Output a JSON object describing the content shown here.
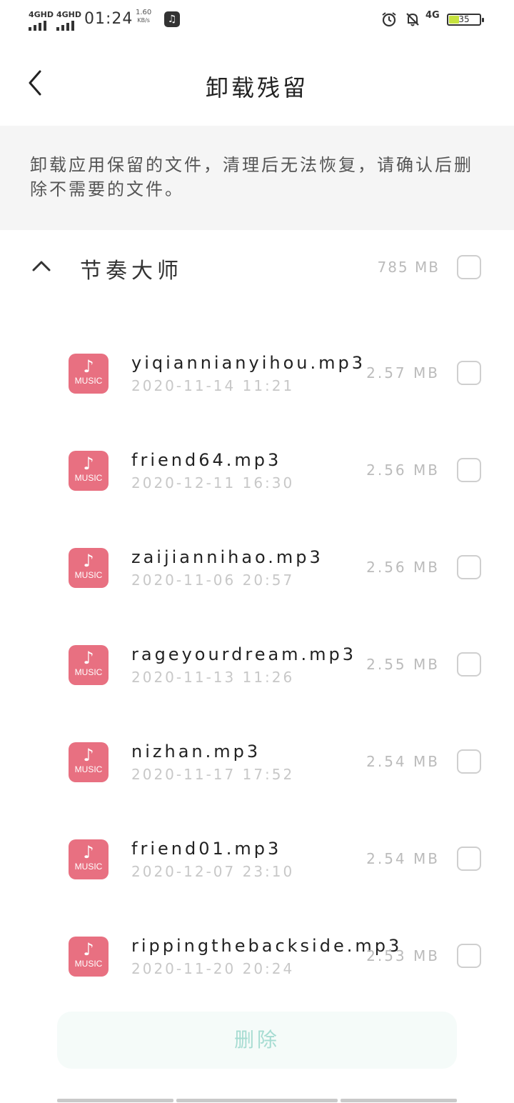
{
  "status_bar": {
    "sim1": "4GHD",
    "sim2": "4GHD",
    "time": "01:24",
    "speed_value": "1.60",
    "speed_unit": "KB/s",
    "network": "4G",
    "battery": "35",
    "icons": [
      "music-icon",
      "alarm-icon",
      "bell-muted-icon"
    ]
  },
  "header": {
    "title": "卸载残留",
    "back_icon": "chevron-left-icon"
  },
  "notice": {
    "text": "卸载应用保留的文件，清理后无法恢复，请确认后删除不需要的文件。"
  },
  "group": {
    "name": "节奏大师",
    "size": "785 MB",
    "expanded_icon": "chevron-up-icon"
  },
  "files": [
    {
      "name": "yiqiannianyihou.mp3",
      "date": "2020-11-14 11:21",
      "size": "2.57 MB",
      "icon_label": "MUSIC"
    },
    {
      "name": "friend64.mp3",
      "date": "2020-12-11 16:30",
      "size": "2.56 MB",
      "icon_label": "MUSIC"
    },
    {
      "name": "zaijiannihao.mp3",
      "date": "2020-11-06 20:57",
      "size": "2.56 MB",
      "icon_label": "MUSIC"
    },
    {
      "name": "rageyourdream.mp3",
      "date": "2020-11-13 11:26",
      "size": "2.55 MB",
      "icon_label": "MUSIC"
    },
    {
      "name": "nizhan.mp3",
      "date": "2020-11-17 17:52",
      "size": "2.54 MB",
      "icon_label": "MUSIC"
    },
    {
      "name": "friend01.mp3",
      "date": "2020-12-07 23:10",
      "size": "2.54 MB",
      "icon_label": "MUSIC"
    },
    {
      "name": "rippingthebackside.mp3",
      "date": "2020-11-20 20:24",
      "size": "2.53 MB",
      "icon_label": "MUSIC"
    }
  ],
  "delete_button": {
    "label": "删除"
  },
  "colors": {
    "icon_bg": "#e87081",
    "delete_text": "#a6dcd2",
    "notice_bg": "#f5f5f5"
  }
}
